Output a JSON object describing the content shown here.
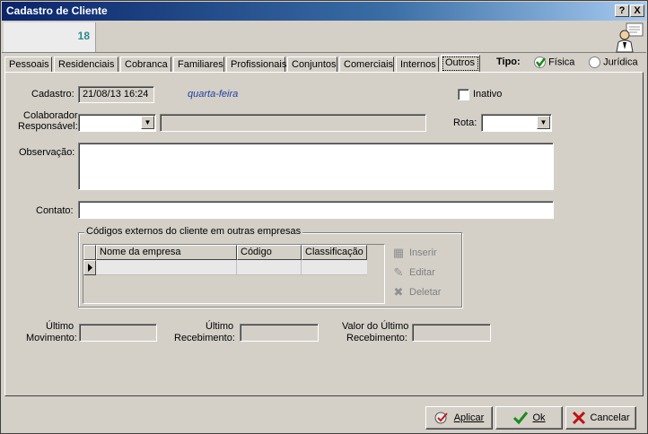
{
  "window": {
    "title": "Cadastro de Cliente",
    "help_btn": "?",
    "close_btn": "X"
  },
  "header": {
    "code": "18"
  },
  "tabs": [
    {
      "label": "Pessoais",
      "active": false
    },
    {
      "label": "Residenciais",
      "active": false
    },
    {
      "label": "Cobranca",
      "active": false
    },
    {
      "label": "Familiares",
      "active": false
    },
    {
      "label": "Profissionais",
      "active": false
    },
    {
      "label": "Conjuntos",
      "active": false
    },
    {
      "label": "Comerciais",
      "active": false
    },
    {
      "label": "Internos",
      "active": false
    },
    {
      "label": "Outros",
      "active": true
    }
  ],
  "tipo": {
    "label": "Tipo:",
    "options": [
      "Física",
      "Jurídica"
    ],
    "selected": "Física"
  },
  "form": {
    "cadastro_label": "Cadastro:",
    "cadastro_value": "21/08/13 16:24",
    "weekday": "quarta-feira",
    "inativo_label": "Inativo",
    "colaborador_label1": "Colaborador",
    "colaborador_label2": "Responsável:",
    "rota_label": "Rota:",
    "observacao_label": "Observação:",
    "contato_label": "Contato:"
  },
  "codigos": {
    "title": "Códigos externos do cliente em outras empresas",
    "columns": [
      "Nome da empresa",
      "Código",
      "Classificação"
    ],
    "actions": {
      "insert": "Inserir",
      "edit": "Editar",
      "delete": "Deletar"
    }
  },
  "summary": {
    "ultimo_mov_1": "Último",
    "ultimo_mov_2": "Movimento:",
    "ultimo_rec_1": "Último",
    "ultimo_rec_2": "Recebimento:",
    "valor_1": "Valor do Último",
    "valor_2": "Recebimento:"
  },
  "buttons": {
    "apply": "Aplicar",
    "ok": "Ok",
    "cancel": "Cancelar"
  }
}
